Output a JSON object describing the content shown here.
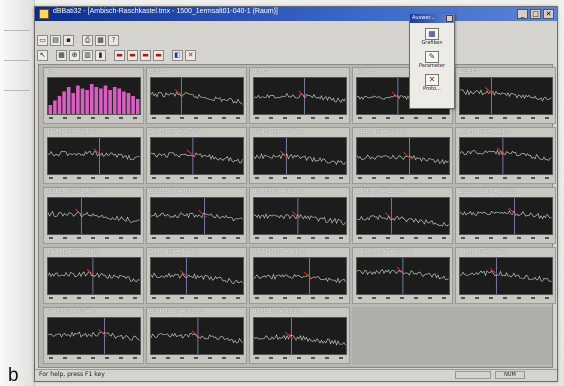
{
  "window": {
    "title": "dBBati32 - [Ambisch-Raschkastel.tmx - 1500_1ermsalt01-040-1 (Raum)]"
  },
  "float_panel": {
    "title": "Auswer...",
    "items": [
      {
        "icon": "bar-chart-icon",
        "label": "Grafiken"
      },
      {
        "icon": "pencil-icon",
        "label": "Parameter"
      },
      {
        "icon": "close-x-icon",
        "label": "Proto..."
      }
    ]
  },
  "toolbar_row1": [
    "new-file-icon",
    "open-file-icon",
    "save-icon",
    "print-icon",
    "help-icon"
  ],
  "toolbar_row2": [
    "cursor-icon",
    "grid-icon",
    "zoom-icon",
    "layout-icon",
    "chart-icon",
    "chart-icon",
    "chart-icon",
    "close-icon"
  ],
  "panels": [
    {
      "label": "RT",
      "type": "bars"
    },
    {
      "label": "63Hz",
      "type": "line",
      "rt": ""
    },
    {
      "label": "80Hz",
      "type": "line",
      "rt": ""
    },
    {
      "label": "100Hz",
      "type": "line",
      "rt": ""
    },
    {
      "label": "125Hz",
      "type": "line",
      "rt": ""
    },
    {
      "label": "160Hz  RT = 0.12 s",
      "type": "line"
    },
    {
      "label": "200Hz  RT = 0.78 s",
      "type": "line"
    },
    {
      "label": "250Hz  RT = 0.62 s",
      "type": "line"
    },
    {
      "label": "315Hz  RT = 0.98 s",
      "type": "line"
    },
    {
      "label": "400Hz  RT = 1.14 s",
      "type": "line"
    },
    {
      "label": "500Hz  RT = 1.46 s",
      "type": "line"
    },
    {
      "label": "630Hz  RT = 0.91 s",
      "type": "line"
    },
    {
      "label": "800Hz  RT = 1.09 s",
      "type": "line"
    },
    {
      "label": "1 kHz  RT = 1.12 s",
      "type": "line"
    },
    {
      "label": "1.25 kHz  RT = 1.38 s",
      "type": "line"
    },
    {
      "label": "1.6 kHz  RT = 1.06 s",
      "type": "line"
    },
    {
      "label": "2 kHz  RT = 1.10 s",
      "type": "line"
    },
    {
      "label": "2.5 kHz  RT = 1.19 s",
      "type": "line"
    },
    {
      "label": "3.15 kHz  RT = 0.99 s",
      "type": "line"
    },
    {
      "label": "4 kHz  RT = 1.10 s",
      "type": "line"
    },
    {
      "label": "5 kHz  RT = 0.94 s",
      "type": "line"
    },
    {
      "label": "6.3 kHz  RT = 0.92 s",
      "type": "line"
    },
    {
      "label": "8 kHz  RT = 0.83 s",
      "type": "line"
    }
  ],
  "rt_bars": [
    0.3,
    0.45,
    0.6,
    0.75,
    0.9,
    0.7,
    0.95,
    0.85,
    0.8,
    1.0,
    0.9,
    0.85,
    0.95,
    0.8,
    0.9,
    0.85,
    0.75,
    0.7,
    0.6,
    0.5
  ],
  "status": {
    "text": "For help, press F1 key",
    "cell1": "",
    "cell2": "NUM"
  },
  "figure_letter": "b",
  "colors": {
    "title_start": "#0b2c8f",
    "plot_bg": "#1c1c1c",
    "trace": "#c8d8c8",
    "trace_red": "#e0303a",
    "bar": "#d65fc0",
    "marker": "#a9b8ff"
  }
}
